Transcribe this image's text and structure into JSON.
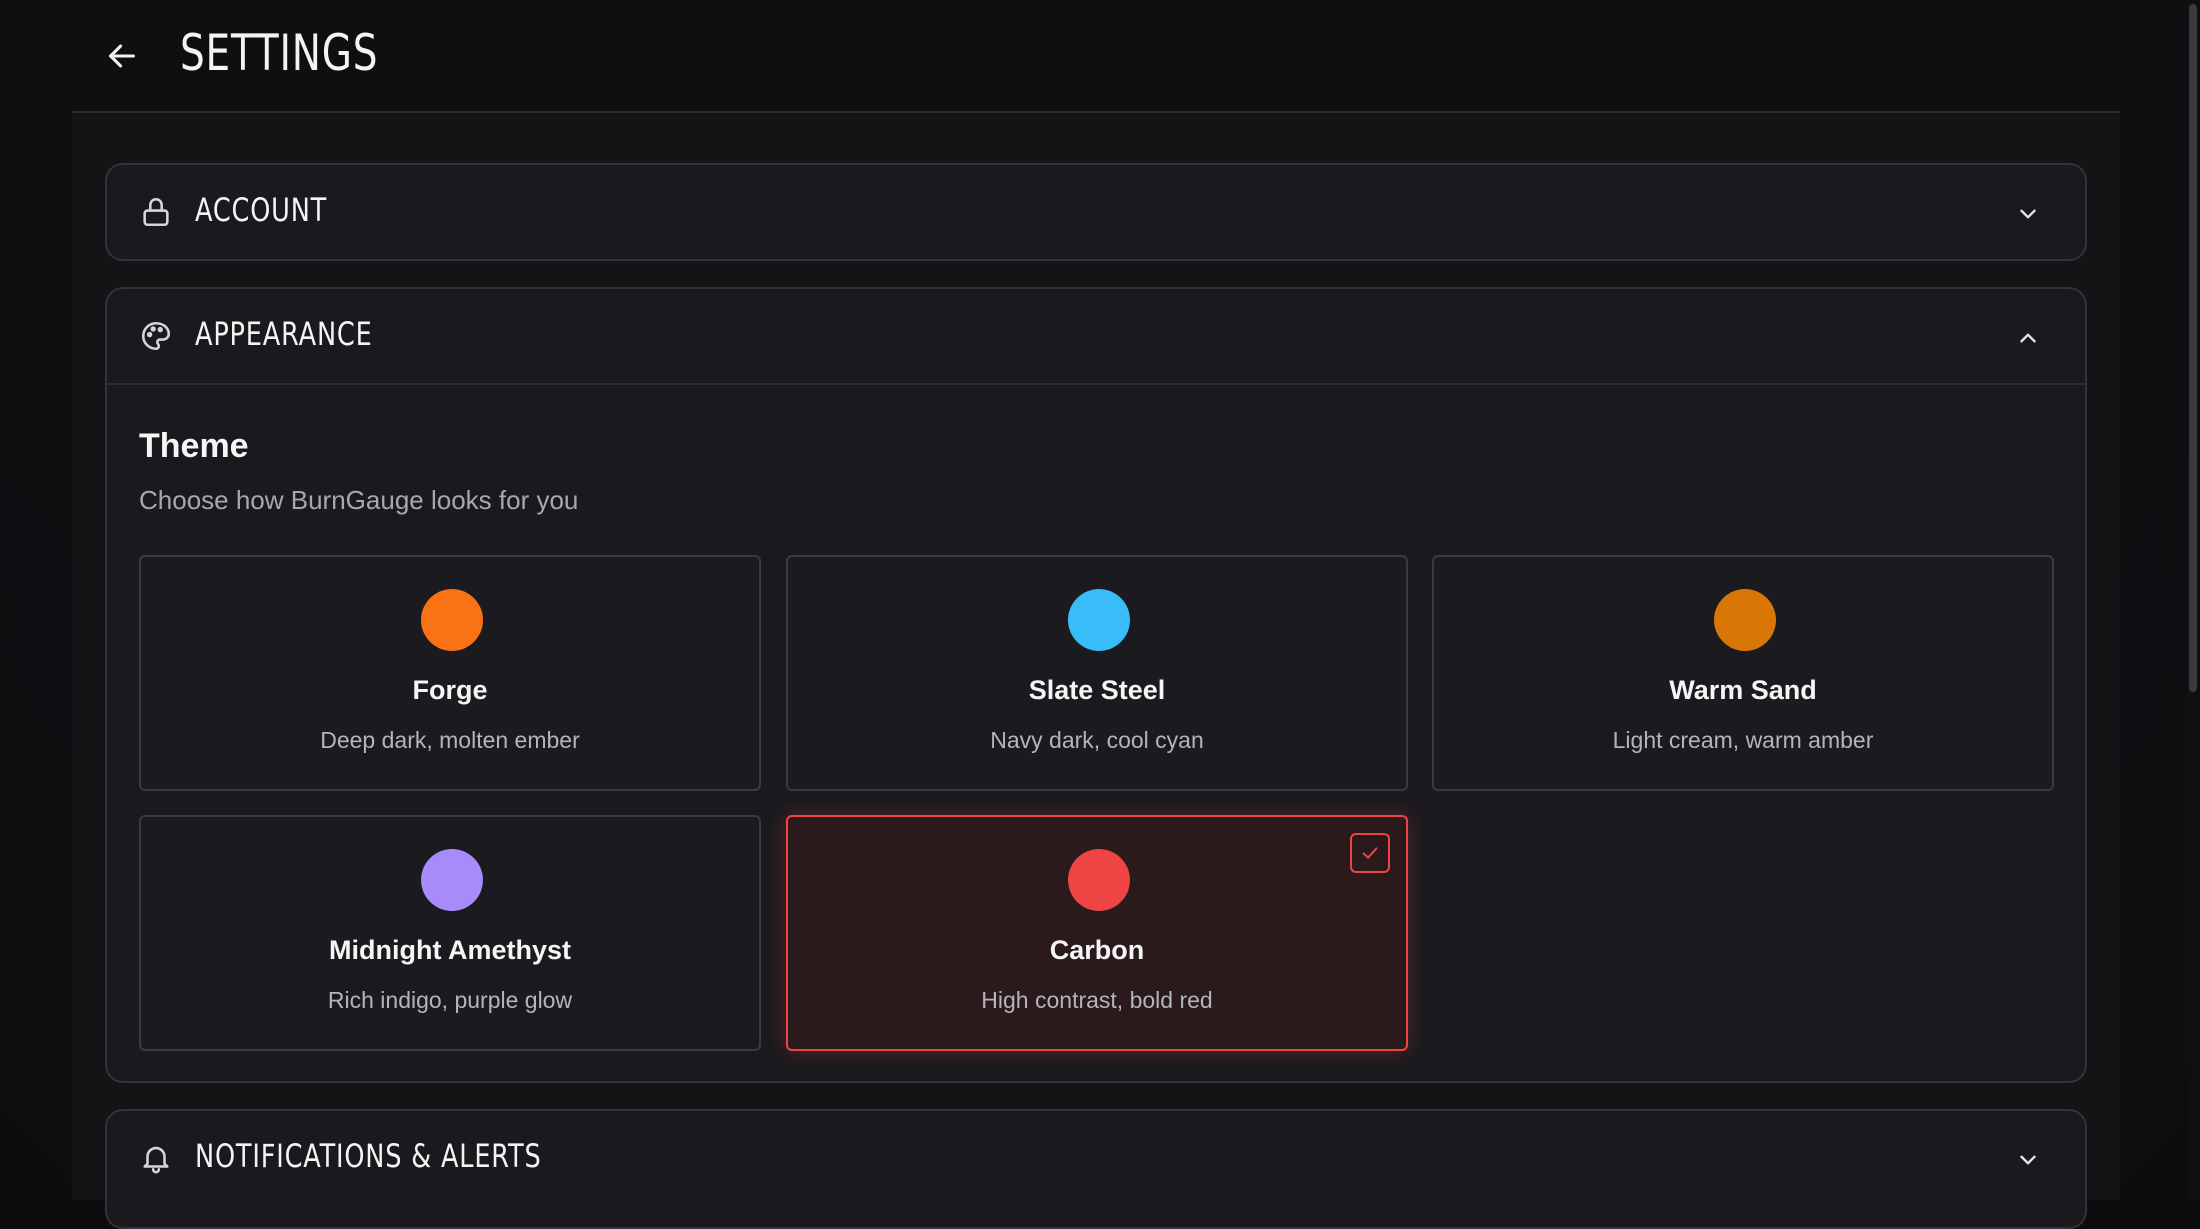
{
  "header": {
    "title": "SETTINGS",
    "back_icon": "arrow-left-icon"
  },
  "sections": {
    "account": {
      "label": "ACCOUNT",
      "icon": "lock-icon",
      "expanded": false
    },
    "appearance": {
      "label": "APPEARANCE",
      "icon": "palette-icon",
      "expanded": true
    },
    "notifications": {
      "label": "NOTIFICATIONS & ALERTS",
      "icon": "bell-icon",
      "expanded": false
    }
  },
  "theme": {
    "title": "Theme",
    "subtitle": "Choose how BurnGauge looks for you",
    "options": [
      {
        "name": "Forge",
        "description": "Deep dark, molten ember",
        "color": "#f97316",
        "selected": false
      },
      {
        "name": "Slate Steel",
        "description": "Navy dark, cool cyan",
        "color": "#38bdf8",
        "selected": false
      },
      {
        "name": "Warm Sand",
        "description": "Light cream, warm amber",
        "color": "#d97706",
        "selected": false
      },
      {
        "name": "Midnight Amethyst",
        "description": "Rich indigo, purple glow",
        "color": "#a78bfa",
        "selected": false
      },
      {
        "name": "Carbon",
        "description": "High contrast, bold red",
        "color": "#ef4444",
        "selected": true
      }
    ]
  },
  "colors": {
    "accent": "#ef4444",
    "background": "#141417",
    "card_border": "#3a3a40"
  }
}
